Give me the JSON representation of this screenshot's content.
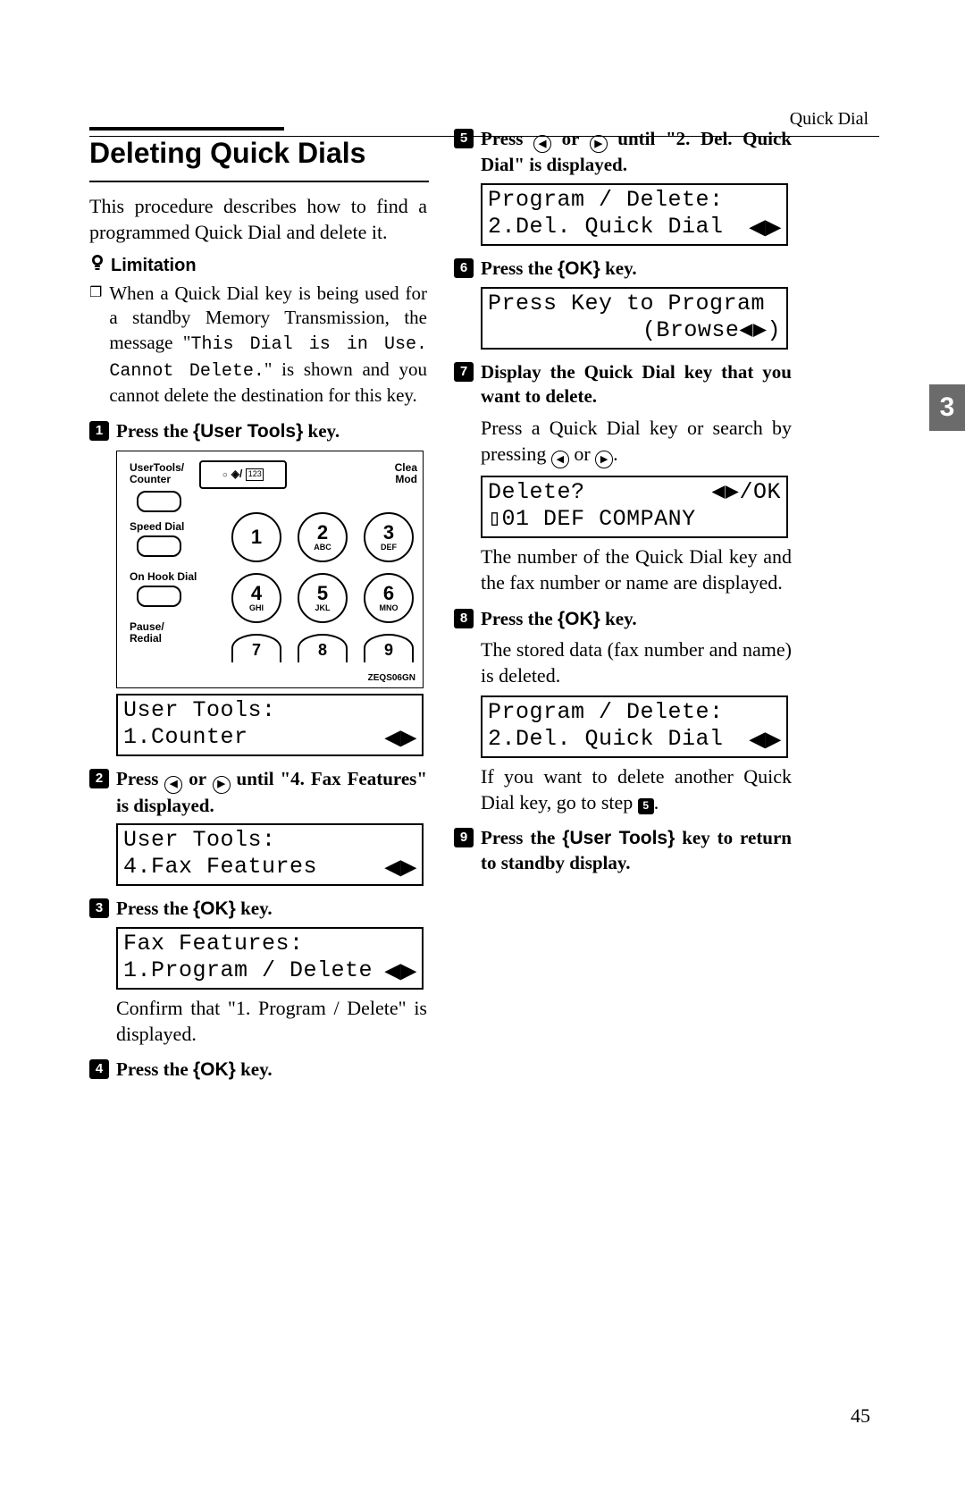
{
  "running_head": "Quick Dial",
  "section_title": "Deleting Quick Dials",
  "intro": "This procedure describes how to find a programmed Quick Dial and delete it.",
  "limitation_label": "Limitation",
  "limitation_body_pre": "When a Quick Dial key is being used for a standby Memory Transmission, the message \"",
  "limitation_mono": "This Dial is in Use. Cannot Delete.",
  "limitation_body_post": "\" is shown and you cannot delete the destination for this key.",
  "keypad": {
    "usertools": "UserTools/\nCounter",
    "clear": "Clea\nMod",
    "speed": "Speed Dial",
    "onhook": "On Hook Dial",
    "pauser": "Pause/\nRedial",
    "disp_box": "123",
    "keys": [
      {
        "n": "1",
        "s": ""
      },
      {
        "n": "2",
        "s": "ABC"
      },
      {
        "n": "3",
        "s": "DEF"
      },
      {
        "n": "4",
        "s": "GHI"
      },
      {
        "n": "5",
        "s": "JKL"
      },
      {
        "n": "6",
        "s": "MNO"
      },
      {
        "n": "7",
        "s": ""
      },
      {
        "n": "8",
        "s": ""
      },
      {
        "n": "9",
        "s": ""
      }
    ],
    "code": "ZEQS06GN"
  },
  "steps": {
    "s1": {
      "pre": "Press the ",
      "key": "User Tools",
      "post": " key."
    },
    "s2": {
      "pre": "Press ",
      "mid": " or ",
      "tail": " until \"4. Fax Features\" is displayed."
    },
    "s3": {
      "pre": "Press the ",
      "key": "OK",
      "post": " key."
    },
    "s3_after": "Confirm that \"1. Program / Delete\" is displayed.",
    "s4": {
      "pre": "Press the ",
      "key": "OK",
      "post": " key."
    },
    "s5": {
      "pre": "Press ",
      "mid": " or ",
      "tail": " until \"2. Del. Quick Dial\" is displayed."
    },
    "s6": {
      "pre": "Press the ",
      "key": "OK",
      "post": " key."
    },
    "s7": "Display the Quick Dial key that you want to delete.",
    "s7_after_a": "Press a Quick Dial key or search by pressing ",
    "s7_after_mid": " or ",
    "s7_after_end": ".",
    "s7_note": "The number of the Quick Dial key and the fax number or name are displayed.",
    "s8": {
      "pre": "Press the ",
      "key": "OK",
      "post": " key."
    },
    "s8_after": "The stored data (fax number and name) is deleted.",
    "s8_note_a": "If you want to delete another Quick Dial key, go to step ",
    "s8_note_num": "5",
    "s8_note_b": ".",
    "s9": {
      "pre": "Press the ",
      "key": "User Tools",
      "post": " key to return to standby display."
    }
  },
  "lcd": {
    "l1": {
      "r1": "User Tools:",
      "r2": "1.Counter"
    },
    "l2": {
      "r1": "User Tools:",
      "r2": "4.Fax Features"
    },
    "l3": {
      "r1": "Fax Features:",
      "r2": "1.Program / Delete"
    },
    "l5": {
      "r1": "Program / Delete:",
      "r2": "2.Del. Quick Dial"
    },
    "l6": {
      "r1": "Press Key to Program",
      "r2": "(Browse◀▶)"
    },
    "l7": {
      "r1a": "Delete?",
      "r1b": "◀▶/OK",
      "r2": "▯01 DEF COMPANY"
    },
    "l8": {
      "r1": "Program / Delete:",
      "r2": "2.Del. Quick Dial"
    }
  },
  "chapter": "3",
  "page_num": "45",
  "arrows": "◀▶"
}
